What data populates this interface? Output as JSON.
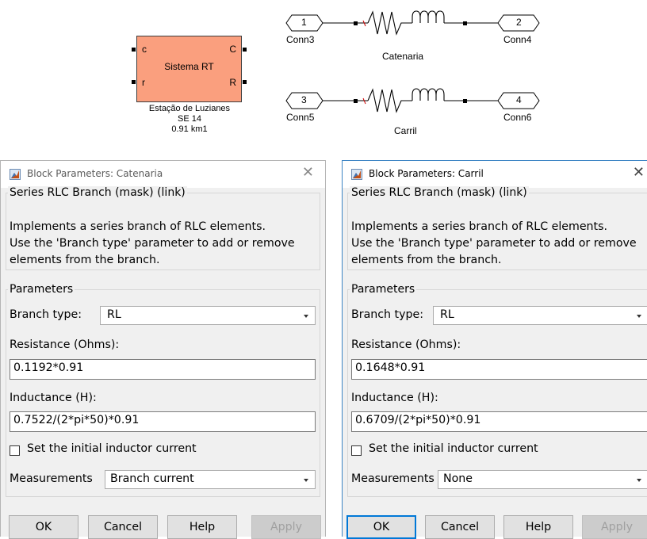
{
  "diagram": {
    "subsystem": {
      "title": "Sistema RT",
      "ports": {
        "in_top": "c",
        "in_bottom": "r",
        "out_top": "C",
        "out_bottom": "R"
      },
      "caption": [
        "Estação de Luzianes",
        "SE 14",
        "0.91 km1"
      ],
      "fill_color": "#fa9f7e"
    },
    "branches": [
      {
        "name": "Catenaria",
        "in_port_num": "1",
        "in_port_label": "Conn3",
        "out_port_num": "2",
        "out_port_label": "Conn4"
      },
      {
        "name": "Carril",
        "in_port_num": "3",
        "in_port_label": "Conn5",
        "out_port_num": "4",
        "out_port_label": "Conn6"
      }
    ]
  },
  "dialogs": [
    {
      "title": "Block Parameters: Catenaria",
      "close_icon": "close-icon",
      "header": "Series RLC Branch (mask) (link)",
      "description": [
        "Implements a series branch of RLC elements.",
        "Use the 'Branch type' parameter to add or remove",
        "elements from the branch."
      ],
      "parameters_label": "Parameters",
      "branch_type_label": "Branch type:",
      "branch_type_value": "RL",
      "resistance_label": "Resistance (Ohms):",
      "resistance_value": "0.1192*0.91",
      "inductance_label": "Inductance (H):",
      "inductance_value": "0.7522/(2*pi*50)*0.91",
      "initial_current_label": "Set the initial inductor current",
      "initial_current_checked": false,
      "measurements_label": "Measurements",
      "measurements_value": "Branch current",
      "buttons": {
        "ok": "OK",
        "cancel": "Cancel",
        "help": "Help",
        "apply": "Apply"
      }
    },
    {
      "title": "Block Parameters: Carril",
      "close_icon": "close-icon",
      "header": "Series RLC Branch (mask) (link)",
      "description": [
        "Implements a series branch of RLC elements.",
        "Use the 'Branch type' parameter to add or remove",
        "elements from the branch."
      ],
      "parameters_label": "Parameters",
      "branch_type_label": "Branch type:",
      "branch_type_value": "RL",
      "resistance_label": "Resistance (Ohms):",
      "resistance_value": "0.1648*0.91",
      "inductance_label": "Inductance (H):",
      "inductance_value": "0.6709/(2*pi*50)*0.91",
      "initial_current_label": "Set the initial inductor current",
      "initial_current_checked": false,
      "measurements_label": "Measurements",
      "measurements_value": "None",
      "buttons": {
        "ok": "OK",
        "cancel": "Cancel",
        "help": "Help",
        "apply": "Apply"
      }
    }
  ]
}
